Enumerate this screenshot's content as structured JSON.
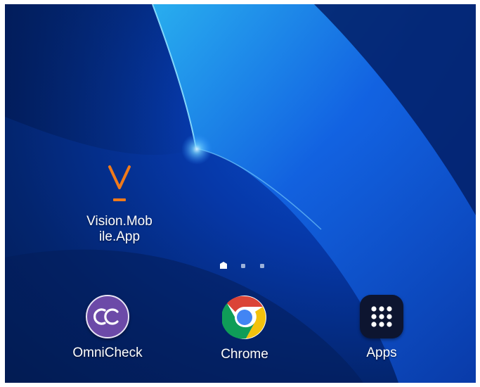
{
  "home_screen": {
    "apps": [
      {
        "label": "Vision.Mob\nile.App",
        "label_line1": "Vision.Mob",
        "label_line2": "ile.App",
        "icon": "vision-v-icon",
        "accent": "#f07a1a"
      }
    ],
    "page_indicator": {
      "pages": 3,
      "current": 1,
      "current_icon": "home-indicator-icon"
    },
    "dock": [
      {
        "label": "OmniCheck",
        "icon": "omnicheck-icon",
        "color": "#6c4aa8"
      },
      {
        "label": "Chrome",
        "icon": "chrome-icon"
      },
      {
        "label": "Apps",
        "icon": "apps-grid-icon",
        "color": "#0d1530"
      }
    ]
  },
  "colors": {
    "wallpaper_primary": "#0638a8",
    "wallpaper_highlight": "#2aa8ff",
    "label_text": "#ffffff"
  }
}
